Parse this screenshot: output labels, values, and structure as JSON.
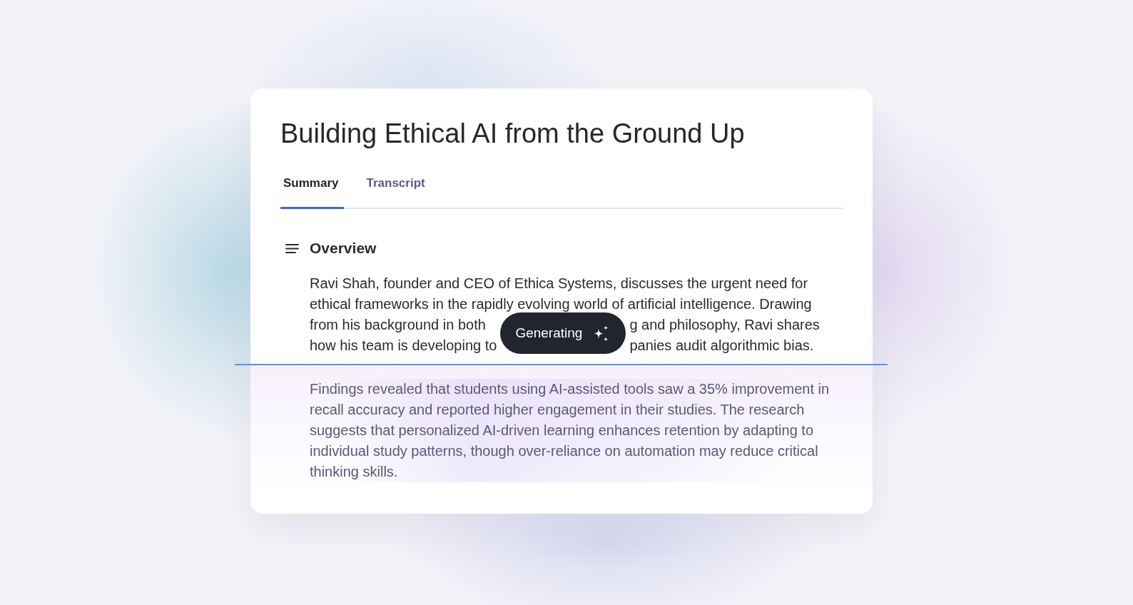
{
  "card": {
    "title": "Building Ethical AI from the Ground Up",
    "tabs": [
      {
        "label": "Summary",
        "selected": true
      },
      {
        "label": "Transcript",
        "selected": false
      }
    ],
    "overview": {
      "heading": "Overview",
      "lines": [
        [
          "Ravi Shah, founder and CEO of Ethica Systems, discusses the urgent need for"
        ],
        [
          "ethical frameworks in the rapidly evolving world of artificial intelligence. Drawing"
        ],
        [
          "from his background in both",
          "g and philosophy, Ravi shares"
        ],
        [
          "how his team is developing to",
          "panies audit algorithmic bias."
        ]
      ],
      "status": {
        "label": "Generating"
      }
    },
    "generated_text": "Findings revealed that students using AI-assisted tools saw a 35% improvement in recall accuracy and reported higher engagement in their studies. The research suggests that personalized AI-driven learning enhances retention by adapting to individual study patterns, though over-reliance on automation may reduce critical thinking skills."
  }
}
